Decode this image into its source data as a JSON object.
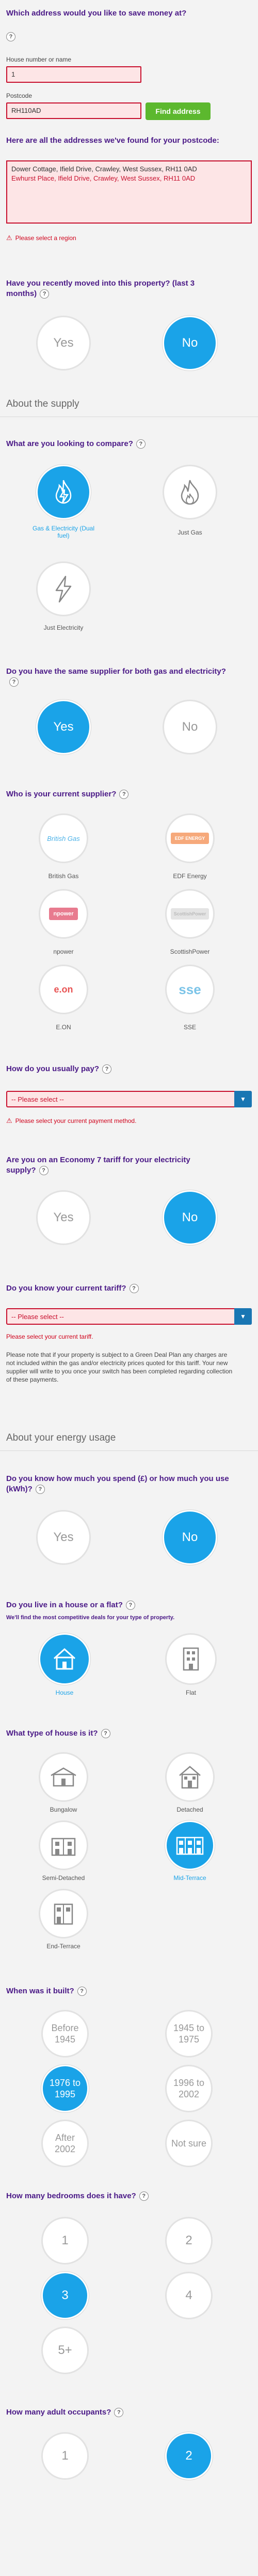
{
  "address": {
    "question": "Which address would you like to save money at?",
    "house_label": "House number or name",
    "house_value": "1",
    "postcode_label": "Postcode",
    "postcode_value": "RH110AD",
    "find_label": "Find address",
    "found_heading": "Here are all the addresses we've found for your postcode:",
    "addresses": [
      "Dower Cottage, Ifield Drive, Crawley, West Sussex, RH11 0AD",
      "Ewhurst Place, Ifield Drive, Crawley, West Sussex, RH11 0AD"
    ],
    "error": "Please select a region"
  },
  "moved": {
    "question": "Have you recently moved into this property? (last 3 months)",
    "yes": "Yes",
    "no": "No",
    "selected": "No"
  },
  "supply_section": "About the supply",
  "compare": {
    "question": "What are you looking to compare?",
    "options": [
      "Gas & Electricity (Dual fuel)",
      "Just Gas",
      "Just Electricity"
    ],
    "selected": "Gas & Electricity (Dual fuel)"
  },
  "same_supplier": {
    "question": "Do you have the same supplier for both gas and electricity?",
    "yes": "Yes",
    "no": "No",
    "selected": "Yes"
  },
  "supplier": {
    "question": "Who is your current supplier?",
    "options": [
      "British Gas",
      "EDF Energy",
      "npower",
      "ScottishPower",
      "E.ON",
      "SSE"
    ],
    "logos": [
      "British Gas",
      "EDF ENERGY",
      "npower",
      "ScottishPower",
      "e.on",
      "sse"
    ]
  },
  "payment": {
    "question": "How do you usually pay?",
    "placeholder": "-- Please select --",
    "error": "Please select your current payment method."
  },
  "economy7": {
    "question": "Are you on an Economy 7 tariff for your electricity supply?",
    "yes": "Yes",
    "no": "No",
    "selected": "No"
  },
  "tariff": {
    "question": "Do you know your current tariff?",
    "placeholder": "-- Please select --",
    "error": "Please select your current tariff.",
    "note": "Please note that if your property is subject to a Green Deal Plan any charges are not included within the gas and/or electricity prices quoted for this tariff. Your new supplier will write to you once your switch has been completed regarding collection of these payments."
  },
  "usage_section": "About your energy usage",
  "spend": {
    "question": "Do you know how much you spend (£) or how much you use (kWh)?",
    "yes": "Yes",
    "no": "No",
    "selected": "No"
  },
  "house_flat": {
    "question": "Do you live in a house or a flat?",
    "subtitle": "We'll find the most competitive deals for your type of property.",
    "options": [
      "House",
      "Flat"
    ],
    "selected": "House"
  },
  "house_type": {
    "question": "What type of house is it?",
    "options": [
      "Bungalow",
      "Detached",
      "Semi-Detached",
      "Mid-Terrace",
      "End-Terrace"
    ],
    "selected": "Mid-Terrace"
  },
  "built": {
    "question": "When was it built?",
    "options": [
      "Before 1945",
      "1945 to 1975",
      "1976 to 1995",
      "1996 to 2002",
      "After 2002",
      "Not sure"
    ],
    "selected": "1976 to 1995"
  },
  "bedrooms": {
    "question": "How many bedrooms does it have?",
    "options": [
      "1",
      "2",
      "3",
      "4",
      "5+"
    ],
    "selected": "3"
  },
  "occupants": {
    "question": "How many adult occupants?",
    "options": [
      "1",
      "2"
    ],
    "selected": "2"
  },
  "colors": {
    "accent": "#1aa3e8",
    "heading": "#4b1a87",
    "error": "#d0021b",
    "button_green": "#5cb82e"
  }
}
